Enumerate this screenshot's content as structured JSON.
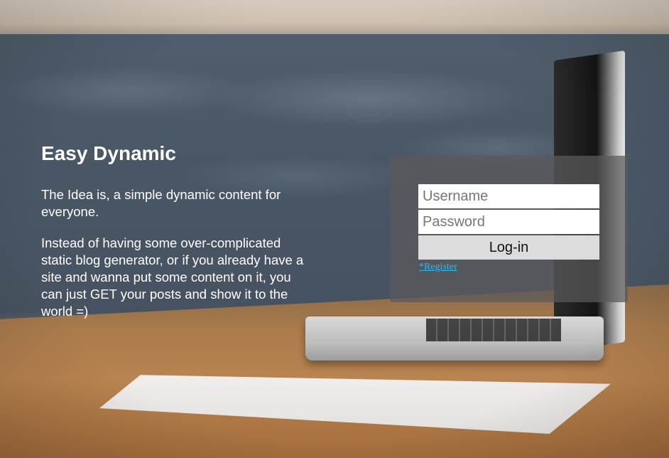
{
  "hero": {
    "title": "Easy Dynamic",
    "paragraph_1": "The Idea is, a simple dynamic content for everyone.",
    "paragraph_2": "Instead of having some over-complicated static blog generator, or if you already have a site and wanna put some content on it, you can just GET your posts and show it to the world =)"
  },
  "login": {
    "username_placeholder": "Username",
    "password_placeholder": "Password",
    "login_label": "Log-in",
    "register_label": "*Register"
  },
  "colors": {
    "link": "#33b7f5",
    "panel_bg": "rgba(90,90,90,0.72)",
    "button_bg": "#dcdcdc",
    "text": "#ffffff"
  }
}
